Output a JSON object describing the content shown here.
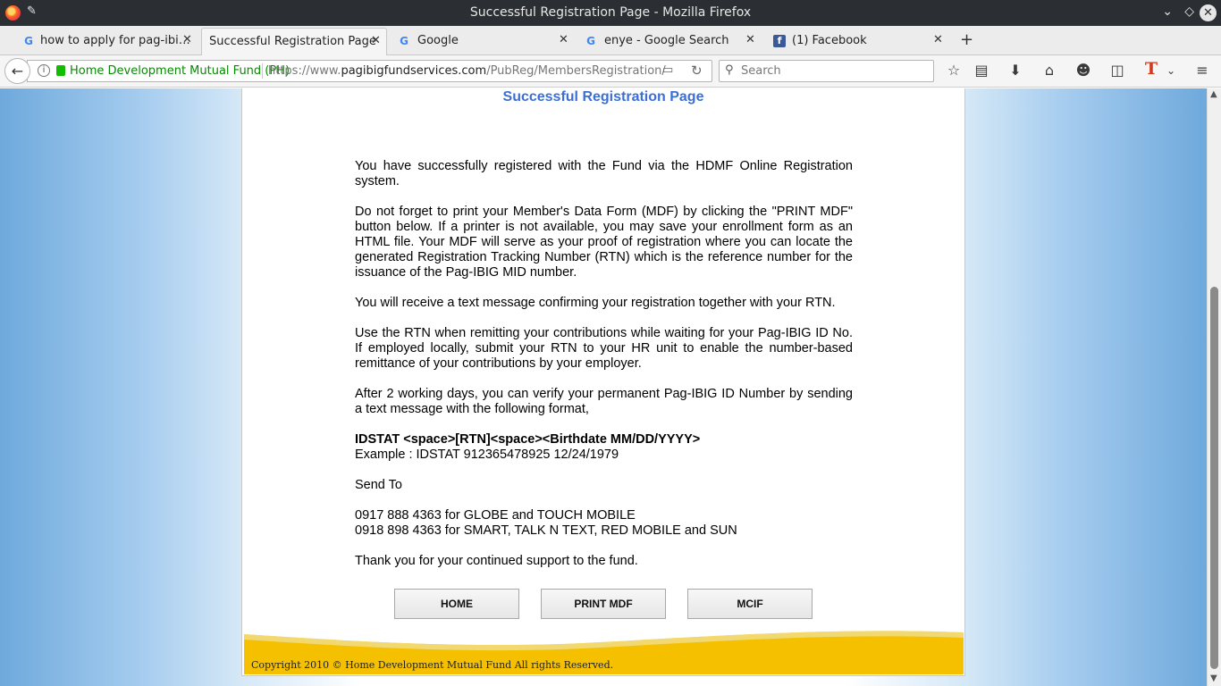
{
  "window": {
    "title": "Successful Registration Page - Mozilla Firefox",
    "icons": [
      "firefox-logo",
      "pin-icon",
      "minimize-icon",
      "maximize-icon",
      "close-icon"
    ]
  },
  "tabs": [
    {
      "label": "how to apply for pag-ibi…",
      "icon": "google-icon",
      "active": false
    },
    {
      "label": "Successful Registration Page",
      "icon": "none",
      "active": true
    },
    {
      "label": "Google",
      "icon": "google-icon",
      "active": false
    },
    {
      "label": "enye - Google Search",
      "icon": "google-icon",
      "active": false
    },
    {
      "label": "(1) Facebook",
      "icon": "facebook-icon",
      "active": false
    }
  ],
  "navbar": {
    "site_identity": "Home Development Mutual Fund (PH)",
    "url_prefix": "https://www.",
    "url_domain": "pagibigfundservices.com",
    "url_path": "/PubReg/MembersRegistration/",
    "search_placeholder": "Search"
  },
  "page": {
    "title": "Successful Registration Page",
    "paragraphs": [
      "You have successfully registered with the Fund via the HDMF Online Registration system.",
      "Do not forget to print your Member's Data Form (MDF) by clicking the \"PRINT MDF\" button below. If a printer is not available, you may save your enrollment form as an HTML file. Your MDF will serve as your proof of registration where you can locate the generated Registration Tracking Number (RTN) which is the reference number for the issuance of the Pag-IBIG MID number.",
      "You will receive a text message confirming your registration together with your RTN.",
      "Use the RTN when remitting your contributions while waiting for your Pag-IBIG ID No. If employed locally, submit your RTN to your HR unit to enable the number-based remittance of your contributions by your employer.",
      "After 2 working days, you can verify your permanent Pag-IBIG ID Number by sending a text message with the following format,"
    ],
    "format": "IDSTAT <space>[RTN]<space><Birthdate MM/DD/YYYY>",
    "example": "Example : IDSTAT 912365478925 12/24/1979",
    "send_to": "Send To",
    "number_globe": "0917 888 4363 for GLOBE and TOUCH MOBILE",
    "number_smart": "0918 898 4363 for SMART, TALK N TEXT, RED MOBILE and SUN",
    "thanks": "Thank you for your continued support to the fund.",
    "buttons": {
      "home": "HOME",
      "print": "PRINT MDF",
      "mcif": "MCIF"
    },
    "copyright": "Copyright 2010 © Home Development Mutual Fund All rights Reserved."
  },
  "colors": {
    "title_blue": "#3c6fd6",
    "footer_yellow": "#f5c000",
    "bg_blue": "#6ea9dc"
  }
}
